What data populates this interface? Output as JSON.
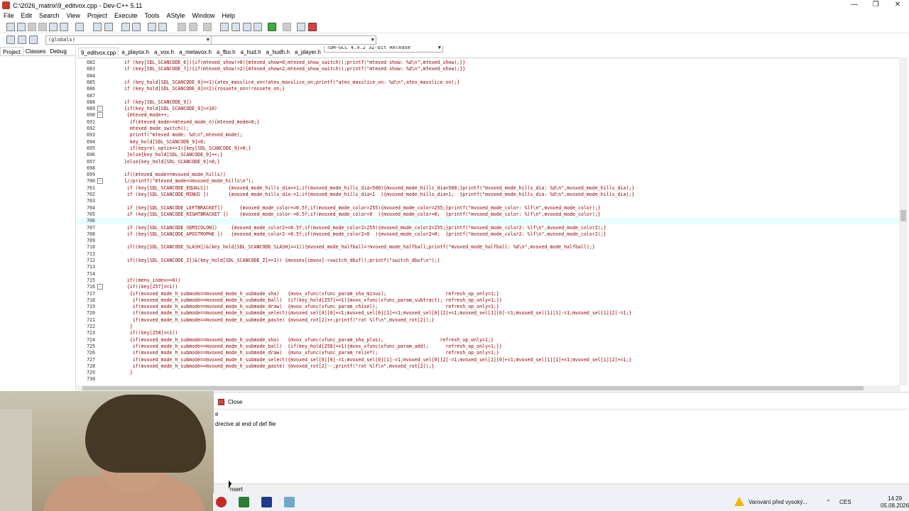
{
  "window": {
    "title": "C:\\2026_matrix\\9_editvox.cpp - Dev-C++ 5.11"
  },
  "menu": [
    "File",
    "Edit",
    "Search",
    "View",
    "Project",
    "Execute",
    "Tools",
    "AStyle",
    "Window",
    "Help"
  ],
  "toolbar": {
    "compiler": "TDM-GCC 4.9.2 32-bit Release",
    "scope": "(globals)"
  },
  "left_tabs": [
    {
      "label": "Project",
      "active": true
    },
    {
      "label": "Classes",
      "active": false
    },
    {
      "label": "Debug",
      "active": false
    }
  ],
  "file_tabs": [
    {
      "label": "9_editvox.cpp",
      "active": true
    },
    {
      "label": "a_playox.h",
      "active": false
    },
    {
      "label": "a_vox.h",
      "active": false
    },
    {
      "label": "a_metavox.h",
      "active": false
    },
    {
      "label": "a_fbo.h",
      "active": false
    },
    {
      "label": "a_hud.h",
      "active": false
    },
    {
      "label": "a_hudh.h",
      "active": false
    },
    {
      "label": "a_player.h",
      "active": false
    }
  ],
  "code_lines": [
    {
      "n": "682",
      "fold": "",
      "t": "    if (key[SDL_SCANCODE_6]){if(mtexed_show!=0){mtexed_show=0;mtexed_show_switch();printf(\"mtexed show: %d\\n\",mtexed_show);}}"
    },
    {
      "n": "683",
      "fold": "",
      "t": "    if (key[SDL_SCANCODE_7]){if(mtexed_show!=2){mtexed_show=2;mtexed_show_switch();printf(\"mtexed show: %d\\n\",mtexed_show);}}"
    },
    {
      "n": "684",
      "fold": "",
      "t": ""
    },
    {
      "n": "685",
      "fold": "",
      "t": "    if (key_hold[SDL_SCANCODE_8]==1){atex_maxslice_on=!atex_maxslice_on;printf(\"atex_maxslice_on: %d\\n\",atex_maxslice_on);}"
    },
    {
      "n": "686",
      "fold": "",
      "t": "    if (key_hold[SDL_SCANCODE_0]==1){rossete_on=!rossete_on;}"
    },
    {
      "n": "687",
      "fold": "",
      "t": ""
    },
    {
      "n": "688",
      "fold": "",
      "t": "    if (key[SDL_SCANCODE_9])"
    },
    {
      "n": "689",
      "fold": "-",
      "t": "    {if(key_hold[SDL_SCANCODE_9]>=10)"
    },
    {
      "n": "690",
      "fold": "-",
      "t": "     {mtexed_mode++;"
    },
    {
      "n": "691",
      "fold": "",
      "t": "      if(mtexed_mode>=mtexed_mode_n){mtexed_mode=0;}"
    },
    {
      "n": "692",
      "fold": "",
      "t": "      mtexed_mode_switch();"
    },
    {
      "n": "693",
      "fold": "",
      "t": "      printf(\"mtexed mode: %d\\n\",mtexed_mode);"
    },
    {
      "n": "694",
      "fold": "",
      "t": "      key_hold[SDL_SCANCODE_9]=0;"
    },
    {
      "n": "695",
      "fold": "",
      "t": "      if(keyrel_optie==1){key[SDL_SCANCODE_9]=0;}"
    },
    {
      "n": "696",
      "fold": "",
      "t": "     }else{key_hold[SDL_SCANCODE_9]++;}"
    },
    {
      "n": "697",
      "fold": "",
      "t": "    }else{key_hold[SDL_SCANCODE_9]=0;}"
    },
    {
      "n": "698",
      "fold": "",
      "t": ""
    },
    {
      "n": "699",
      "fold": "",
      "t": "    if((mtexed_mode==mvoxed_mode_hills))"
    },
    {
      "n": "700",
      "fold": "-",
      "t": "    {//printf(\"mtexed_mode==mvoxed_mode_hills\\n\");"
    },
    {
      "n": "701",
      "fold": "",
      "t": "     if (key[SDL_SCANCODE_EQUALS])       {mvoxed_mode_hills_dia+=1;if(mvoxed_mode_hills_dia>500){mvoxed_mode_hills_dia=500;}printf(\"mvoxed_mode_hills_dia: %d\\n\",mvoxed_mode_hills_dia);}"
    },
    {
      "n": "702",
      "fold": "",
      "t": "     if (key[SDL_SCANCODE_MINUS ])       {mvoxed_mode_hills_dia-=1;if(mvoxed_mode_hills_dia<1  ){mvoxed_mode_hills_dia=1;  }printf(\"mvoxed_mode_hills_dia: %d\\n\",mvoxed_mode_hills_dia);}"
    },
    {
      "n": "703",
      "fold": "",
      "t": ""
    },
    {
      "n": "704",
      "fold": "",
      "t": "     if (key[SDL_SCANCODE_LEFTBRACKET])      {mvoxed_mode_color+=0.5f;if(mvoxed_mode_color>255){mvoxed_mode_color=255;}printf(\"mvoxed_mode_color: %lf\\n\",mvoxed_mode_color);}"
    },
    {
      "n": "705",
      "fold": "",
      "t": "     if (key[SDL_SCANCODE_RIGHTBRACKET ])    {mvoxed_mode_color-=0.5f;if(mvoxed_mode_color<0  ){mvoxed_mode_color=0;  }printf(\"mvoxed_mode_color: %lf\\n\",mvoxed_mode_color);}"
    },
    {
      "n": "706",
      "fold": "",
      "t": ""
    },
    {
      "n": "707",
      "fold": "",
      "t": "     if (key[SDL_SCANCODE_SEMICOLON])     {mvoxed_mode_color2+=0.5f;if(mvoxed_mode_color2>255){mvoxed_mode_color2=255;}printf(\"mvoxed_mode_color2: %lf\\n\",mvoxed_mode_color2);}"
    },
    {
      "n": "708",
      "fold": "",
      "t": "     if (key[SDL_SCANCODE_APOSTROPHE ])   {mvoxed_mode_color2-=0.5f;if(mvoxed_mode_color2<0  ){mvoxed_mode_color2=0;  }printf(\"mvoxed_mode_color2: %lf\\n\",mvoxed_mode_color2);}"
    },
    {
      "n": "709",
      "fold": "",
      "t": ""
    },
    {
      "n": "710",
      "fold": "",
      "t": "     if((key[SDL_SCANCODE_SLASH])&(key_hold[SDL_SCANCODE_SLASH]==1)){mvoxed_mode_halfball=!mvoxed_mode_halfball;printf(\"mvoxed_mode_halfball: %d\\n\",mvoxed_mode_halfball);}"
    },
    {
      "n": "711",
      "fold": "",
      "t": ""
    },
    {
      "n": "712",
      "fold": "",
      "t": "     if((key[SDL_SCANCODE_Z])&(key_hold[SDL_SCANCODE_Z]==1)) {mvoxes[imvox]->switch_dbuf();printf(\"switch_dbuf\\n\");}"
    },
    {
      "n": "713",
      "fold": "",
      "t": ""
    },
    {
      "n": "714",
      "fold": "",
      "t": ""
    },
    {
      "n": "715",
      "fold": "",
      "t": "     if((menu_index==0))"
    },
    {
      "n": "716",
      "fold": "-",
      "t": "     {if((key[257]==1))"
    },
    {
      "n": "717",
      "fold": "",
      "t": "      {if(mvoxed_mode_h_submode==mvoxed_mode_h_submode_sha)   {mvox_xfunc(xfunc_param_sha_minus);                     refresh_op_only=1;}"
    },
    {
      "n": "718",
      "fold": "",
      "t": "       if(mvoxed_mode_h_submode==mvoxed_mode_h_submode_ball)  {if(key_hold[257]==1){mvox_xfunc(xfunc_param_subtract); refresh_op_only=1;}}"
    },
    {
      "n": "719",
      "fold": "",
      "t": "       if(mvoxed_mode_h_submode==mvoxed_mode_h_submode_draw)  {mvox_xfunc(xfunc_param_chisel);                        refresh_op_only=1;}"
    },
    {
      "n": "720",
      "fold": "",
      "t": "       if(mvoxed_mode_h_submode==mvoxed_mode_h_submode_select){mvoxed_sel[0][0]+=1;mvoxed_sel[0][1]+=1;mvoxed_sel[0][2]+=1;mvoxed_sel[1][0]-=1;mvoxed_sel[1][1]-=1;mvoxed_sel[1][2]-=1;}"
    },
    {
      "n": "721",
      "fold": "",
      "t": "       if(mvoxed_mode_h_submode==mvoxed_mode_h_submode_paste) {mvoxed_rot[2]++;printf(\"rot %lf\\n\",mvoxed_rot[2]);}"
    },
    {
      "n": "722",
      "fold": "",
      "t": "      }"
    },
    {
      "n": "723",
      "fold": "",
      "t": "      if((key[258]==1))"
    },
    {
      "n": "724",
      "fold": "",
      "t": "      {if(mvoxed_mode_h_submode==mvoxed_mode_h_submode_sha)   {mvox_xfunc(xfunc_param_sha_plus);                    refresh_op_only=1;}"
    },
    {
      "n": "725",
      "fold": "",
      "t": "       if(mvoxed_mode_h_submode==mvoxed_mode_h_submode_ball)  {if(key_hold[258]==1){mvox_xfunc(xfunc_param_add);      refresh_op_only=1;}}"
    },
    {
      "n": "726",
      "fold": "",
      "t": "       if(mvoxed_mode_h_submode==mvoxed_mode_h_submode_draw)  {mvox_xfunc(xfunc_param_relief);                        refresh_op_only=1;}"
    },
    {
      "n": "727",
      "fold": "",
      "t": "       if(mvoxed_mode_h_submode==mvoxed_mode_h_submode_select){mvoxed_sel[0][0]-=1;mvoxed_sel[0][1]-=1;mvoxed_sel[0][2]-=1;mvoxed_sel[1][0]+=1;mvoxed_sel[1][1]+=1;mvoxed_sel[1][2]+=1;}"
    },
    {
      "n": "728",
      "fold": "",
      "t": "       if(mvoxed_mode_h_submode==mvoxed_mode_h_submode_paste) {mvoxed_rot[2]--;printf(\"rot %lf\\n\",mvoxed_rot[2]);}"
    },
    {
      "n": "729",
      "fold": "",
      "t": "      }"
    },
    {
      "n": "730",
      "fold": "",
      "t": ""
    }
  ],
  "highlighted_line": "706",
  "bottom": {
    "close_label": "Close",
    "message_partial": "e",
    "message": "drectve at end of def file",
    "status_mode": "nsert"
  },
  "tray": {
    "notification": "Varování před vysoký...",
    "language": "CES",
    "time": "14:29",
    "date": "05.08.2026"
  },
  "colors": {
    "code_text": "#8b0000",
    "highlight_line": "#e8ffff",
    "warning": "#f2b600"
  }
}
